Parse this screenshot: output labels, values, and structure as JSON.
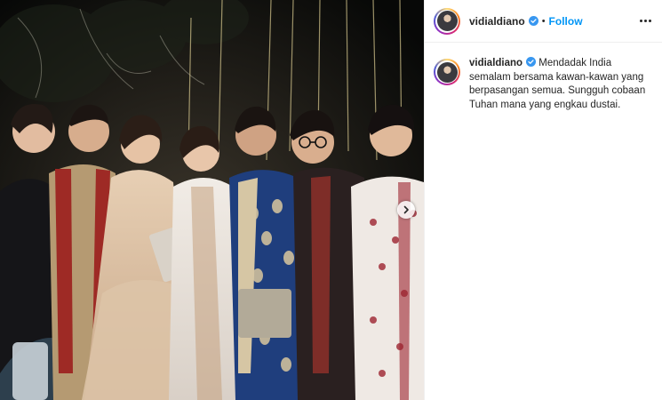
{
  "post": {
    "header": {
      "username": "vidialdiano",
      "separator": "•",
      "follow_label": "Follow",
      "more_icon": "more-horizontal-icon"
    },
    "caption": {
      "username": "vidialdiano",
      "text": "Mendadak India semalam bersama kawan-kawan yang berpasangan semua. Sungguh cobaan Tuhan mana yang engkau dustai."
    },
    "media": {
      "carousel_next_icon": "chevron-right-icon"
    },
    "colors": {
      "follow": "#0095f6",
      "verified": "#3897f0",
      "text": "#262626",
      "border": "#efefef"
    }
  }
}
